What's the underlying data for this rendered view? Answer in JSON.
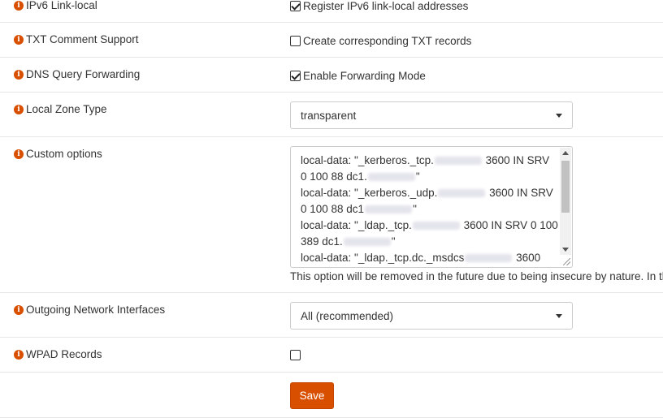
{
  "rows": {
    "ipv6_link_local": {
      "label": "IPv6 Link-local",
      "checkbox_label": "Register IPv6 link-local addresses",
      "checked": true
    },
    "txt_comment": {
      "label": "TXT Comment Support",
      "checkbox_label": "Create corresponding TXT records",
      "checked": false
    },
    "dns_query_forwarding": {
      "label": "DNS Query Forwarding",
      "checkbox_label": "Enable Forwarding Mode",
      "checked": true
    },
    "local_zone_type": {
      "label": "Local Zone Type",
      "selected": "transparent"
    },
    "custom_options": {
      "label": "Custom options",
      "lines": [
        [
          "local-data: \"_kerberos._tcp.",
          "blur",
          " 3600 IN SRV"
        ],
        [
          "0 100 88 dc1.",
          "blur",
          "\""
        ],
        [
          "local-data: \"_kerberos._udp.",
          "blur",
          " 3600 IN SRV"
        ],
        [
          "0 100 88 dc1",
          "blur",
          "\""
        ],
        [
          "local-data: \"_ldap._tcp.",
          "blur",
          " 3600 IN SRV 0 100"
        ],
        [
          "389 dc1.",
          "blur",
          "\""
        ],
        [
          "local-data: \"_ldap._tcp.dc._msdcs",
          "blur",
          " 3600"
        ]
      ],
      "help": "This option will be removed in the future due to being insecure by nature. In the"
    },
    "outgoing_interfaces": {
      "label": "Outgoing Network Interfaces",
      "selected": "All (recommended)"
    },
    "wpad_records": {
      "label": "WPAD Records",
      "checked": false
    }
  },
  "save_label": "Save",
  "colors": {
    "accent": "#d94f00",
    "border": "#cccccc",
    "row_divider": "#e6e6e6"
  }
}
